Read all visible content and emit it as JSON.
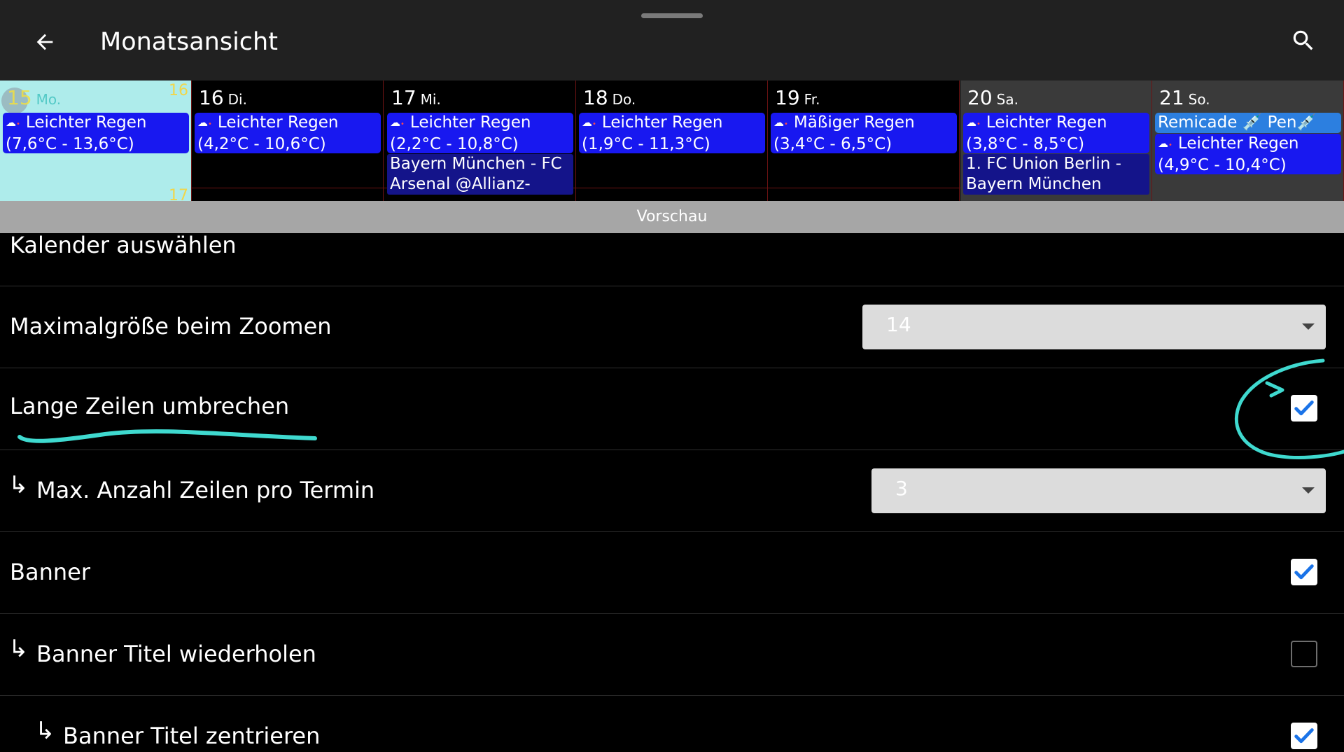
{
  "header": {
    "title": "Monatsansicht",
    "back_icon": "arrow-left-icon",
    "search_icon": "search-icon"
  },
  "calendar": {
    "week_numbers": [
      "16",
      "17"
    ],
    "days": [
      {
        "num": "15",
        "weekday": "Mo.",
        "events": [
          {
            "text": "Leichter Regen",
            "weather": true
          },
          {
            "text": "(7,6°C - 13,6°C)"
          }
        ]
      },
      {
        "num": "16",
        "weekday": "Di.",
        "events": [
          {
            "text": "Leichter Regen",
            "weather": true
          },
          {
            "text": "(4,2°C - 10,6°C)"
          }
        ]
      },
      {
        "num": "17",
        "weekday": "Mi.",
        "events": [
          {
            "text": "Leichter Regen",
            "weather": true
          },
          {
            "text": "(2,2°C - 10,8°C)"
          },
          {
            "text": "Bayern München - FC"
          },
          {
            "text": "Arsenal @Allianz-"
          }
        ]
      },
      {
        "num": "18",
        "weekday": "Do.",
        "events": [
          {
            "text": "Leichter Regen",
            "weather": true
          },
          {
            "text": "(1,9°C - 11,3°C)"
          }
        ]
      },
      {
        "num": "19",
        "weekday": "Fr.",
        "events": [
          {
            "text": "Mäßiger Regen",
            "weather": true
          },
          {
            "text": "(3,4°C - 6,5°C)"
          }
        ]
      },
      {
        "num": "20",
        "weekday": "Sa.",
        "events": [
          {
            "text": "Leichter Regen",
            "weather": true
          },
          {
            "text": "(3,8°C - 8,5°C)"
          },
          {
            "text": "1. FC Union Berlin -"
          },
          {
            "text": "Bayern München"
          }
        ]
      },
      {
        "num": "21",
        "weekday": "So.",
        "events": [
          {
            "text": "Remicade 💉 Pen💉"
          },
          {
            "text": "Leichter Regen",
            "weather": true
          },
          {
            "text": "(4,9°C - 10,4°C)"
          }
        ]
      }
    ],
    "preview_label": "Vorschau"
  },
  "settings": {
    "select_calendar": "Kalender auswählen",
    "max_zoom_label": "Maximalgröße beim Zoomen",
    "max_zoom_value": "14",
    "wrap_lines_label": "Lange Zeilen umbrechen",
    "wrap_lines_checked": true,
    "max_lines_label": "Max. Anzahl Zeilen pro Termin",
    "max_lines_value": "3",
    "banner_label": "Banner",
    "banner_checked": true,
    "banner_repeat_label": "Banner Titel wiederholen",
    "banner_repeat_checked": false,
    "banner_center_label": "Banner Titel zentrieren",
    "banner_center_checked": true,
    "sub_arrow": "↳"
  },
  "colors": {
    "event_blue": "#1818f0",
    "today_bg": "#aeeceb",
    "annotation": "#3fd9cf",
    "check_blue": "#1a73e8"
  }
}
